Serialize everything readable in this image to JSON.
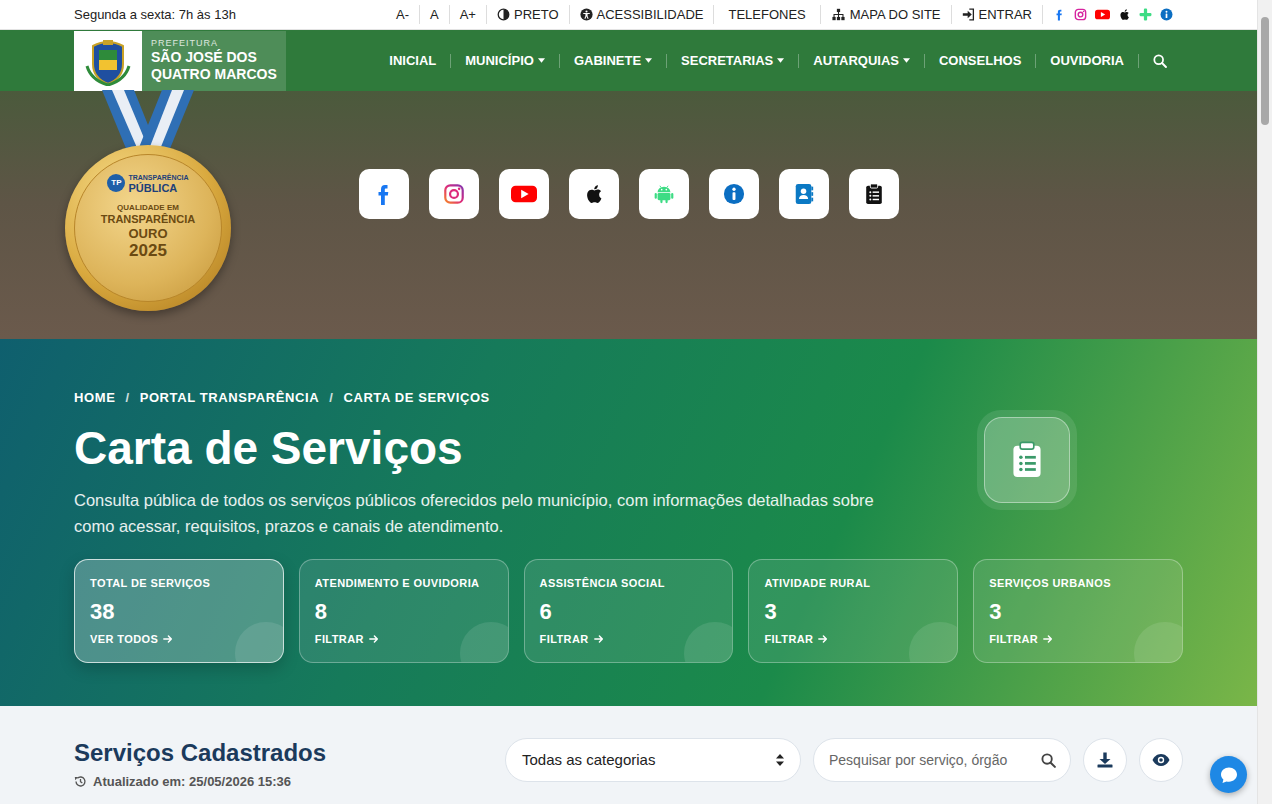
{
  "topbar": {
    "hours": "Segunda a sexta: 7h às 13h",
    "font_sizes": [
      "A-",
      "A",
      "A+"
    ],
    "links": [
      {
        "label": "PRETO"
      },
      {
        "label": "ACESSIBILIDADE"
      },
      {
        "label": "TELEFONES"
      },
      {
        "label": "MAPA DO SITE"
      },
      {
        "label": "ENTRAR"
      }
    ]
  },
  "brand": {
    "kicker": "PREFEITURA",
    "name_lines": [
      "SÃO JOSÉ DOS",
      "QUATRO MARCOS"
    ]
  },
  "nav": [
    {
      "label": "INICIAL",
      "dropdown": false
    },
    {
      "label": "MUNICÍPIO",
      "dropdown": true
    },
    {
      "label": "GABINETE",
      "dropdown": true
    },
    {
      "label": "SECRETARIAS",
      "dropdown": true
    },
    {
      "label": "AUTARQUIAS",
      "dropdown": true
    },
    {
      "label": "CONSELHOS",
      "dropdown": false
    },
    {
      "label": "OUVIDORIA",
      "dropdown": false
    }
  ],
  "medal": {
    "logo": "TP",
    "org": [
      "TRANSPARÊNCIA",
      "PÚBLICA"
    ],
    "lines": [
      "QUALIDADE EM",
      "TRANSPARÊNCIA",
      "OURO",
      "2025"
    ]
  },
  "breadcrumb": {
    "items": [
      "HOME",
      "PORTAL TRANSPARÊNCIA",
      "CARTA DE SERVIÇOS"
    ],
    "separator": "/"
  },
  "page": {
    "title": "Carta de Serviços",
    "description": "Consulta pública de todos os serviços públicos oferecidos pelo município, com informações detalhadas sobre como acessar, requisitos, prazos e canais de atendimento."
  },
  "stats": [
    {
      "label": "TOTAL DE SERVIÇOS",
      "count": "38",
      "action": "VER TODOS",
      "selected": true
    },
    {
      "label": "ATENDIMENTO E OUVIDORIA",
      "count": "8",
      "action": "FILTRAR",
      "selected": false
    },
    {
      "label": "ASSISTÊNCIA SOCIAL",
      "count": "6",
      "action": "FILTRAR",
      "selected": false
    },
    {
      "label": "ATIVIDADE RURAL",
      "count": "3",
      "action": "FILTRAR",
      "selected": false
    },
    {
      "label": "SERVIÇOS URBANOS",
      "count": "3",
      "action": "FILTRAR",
      "selected": false
    }
  ],
  "list": {
    "title": "Serviços Cadastrados",
    "updated": "Atualizado em: 25/05/2026 15:36",
    "category": "Todas as categorias",
    "search_placeholder": "Pesquisar por serviço, órgão"
  }
}
